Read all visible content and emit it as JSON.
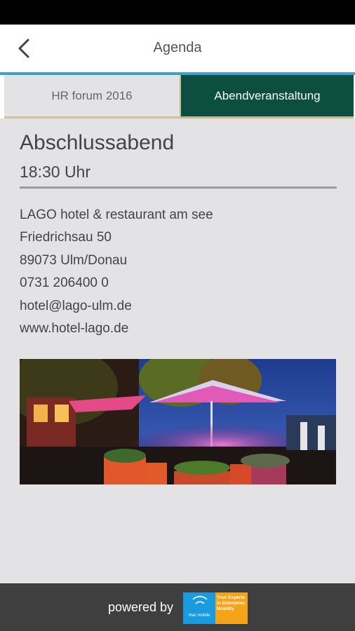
{
  "header": {
    "title": "Agenda",
    "back_icon": "chevron-left-icon"
  },
  "tabs": [
    {
      "label": "HR forum 2016",
      "active": false
    },
    {
      "label": "Abendveranstaltung",
      "active": true
    }
  ],
  "event": {
    "title": "Abschlussabend",
    "time": "18:30 Uhr",
    "address": [
      "LAGO hotel & restaurant am see",
      "Friedrichsau 50",
      "89073 Ulm/Donau",
      "0731 206400 0",
      "hotel@lago-ulm.de",
      "www.hotel-lago.de"
    ]
  },
  "footer": {
    "powered_by": "powered by",
    "logo_left_text": "mac mobile",
    "logo_right_text": "Your Experts in Enterprise Mobility"
  },
  "colors": {
    "accent_rule": "#3aa0d8",
    "active_tab": "#0c4f40",
    "tab_border": "#c9b98e",
    "logo_blue": "#1a9be0",
    "logo_orange": "#f5a41a"
  }
}
